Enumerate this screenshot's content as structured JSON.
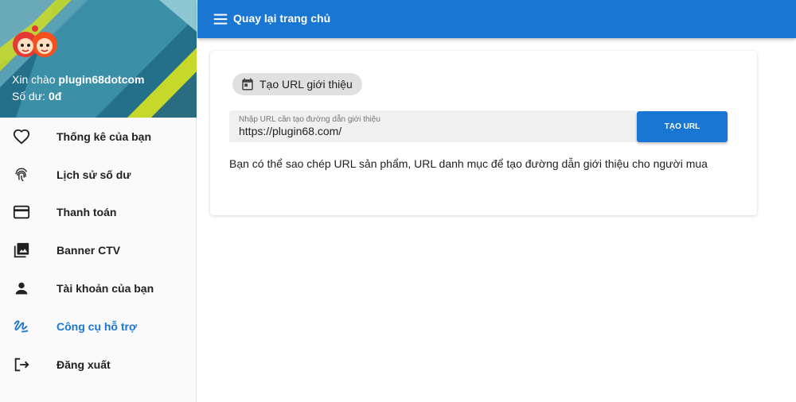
{
  "user": {
    "greeting_prefix": "Xin chào",
    "username": "plugin68dotcom",
    "balance_prefix": "Số dư:",
    "balance_value": "0đ"
  },
  "sidebar": {
    "items": [
      {
        "label": "Thống kê của bạn",
        "icon": "heart-icon"
      },
      {
        "label": "Lịch sử số dư",
        "icon": "fingerprint-icon"
      },
      {
        "label": "Thanh toán",
        "icon": "credit-card-icon"
      },
      {
        "label": "Banner CTV",
        "icon": "photo-library-icon"
      },
      {
        "label": "Tài khoản của bạn",
        "icon": "person-icon"
      },
      {
        "label": "Công cụ hỗ trợ",
        "icon": "gesture-icon",
        "active": true
      },
      {
        "label": "Đăng xuất",
        "icon": "logout-icon"
      }
    ]
  },
  "topbar": {
    "title": "Quay lại trang chủ",
    "menu_icon": "hamburger-menu-icon"
  },
  "card": {
    "chip_label": "Tạo URL giới thiệu",
    "chip_icon": "calendar-icon",
    "field_label": "Nhập URL cần tạo đường dẫn giới thiệu",
    "field_value": "https://plugin68.com/",
    "button_label": "TẠO URL",
    "help_text": "Bạn có thể sao chép URL sản phẩm, URL danh mục để tạo đường dẫn giới thiệu cho người mua"
  },
  "colors": {
    "primary": "#1976d2",
    "header_teal": "#1f6f8b",
    "accent_yellow": "#c6d92a"
  }
}
